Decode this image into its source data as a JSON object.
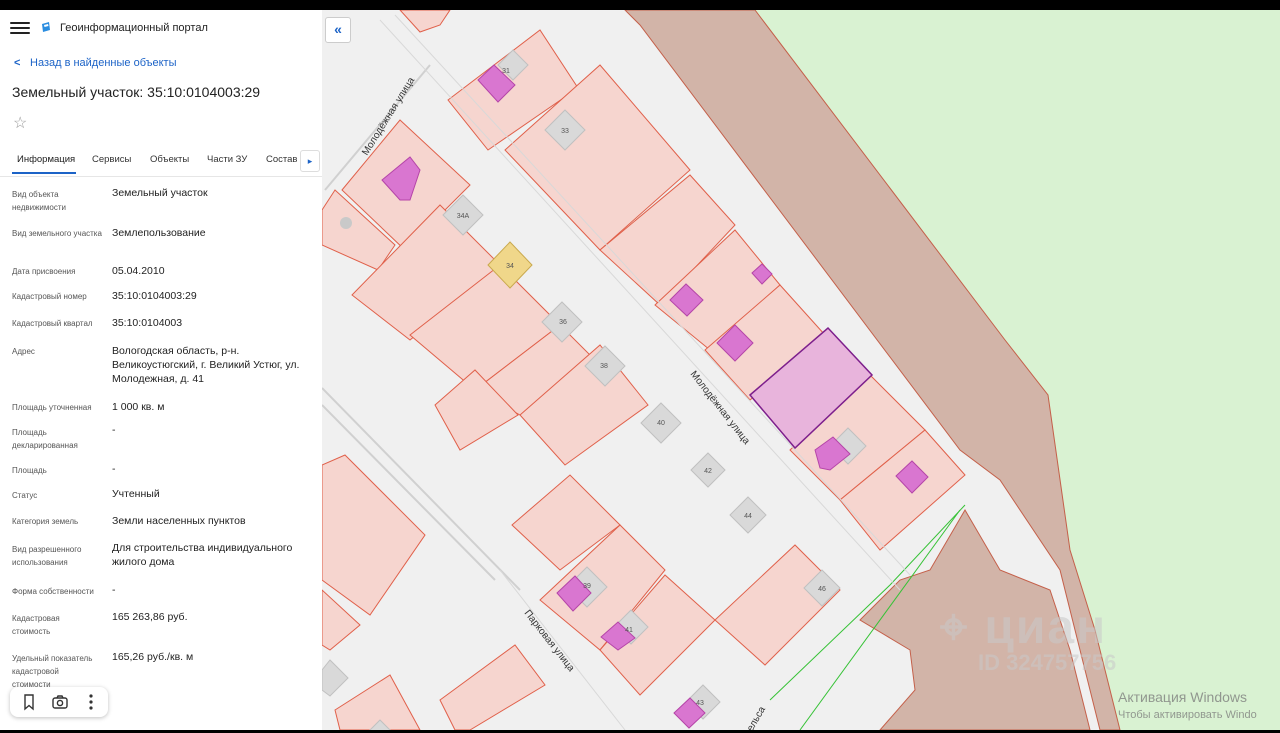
{
  "header": {
    "app_title": "Геоинформационный портал"
  },
  "nav": {
    "back_label": "Назад в найденные объекты"
  },
  "object": {
    "title": "Земельный участок: 35:10:0104003:29"
  },
  "tabs": [
    "Информация",
    "Сервисы",
    "Объекты",
    "Части ЗУ",
    "Состав"
  ],
  "active_tab": "Информация",
  "info": [
    {
      "label": "Вид объекта недвижимости",
      "value": "Земельный участок"
    },
    {
      "label": "Вид земельного участка",
      "value": "Землепользование"
    },
    {
      "label": "Дата присвоения",
      "value": "05.04.2010"
    },
    {
      "label": "Кадастровый номер",
      "value": "35:10:0104003:29"
    },
    {
      "label": "Кадастровый квартал",
      "value": "35:10:0104003"
    },
    {
      "label": "Адрес",
      "value": "Вологодская область, р-н. Великоустюгский, г. Великий Устюг, ул. Молодежная, д. 41"
    },
    {
      "label": "Площадь уточненная",
      "value": "1 000 кв. м"
    },
    {
      "label": "Площадь декларированная",
      "value": "-"
    },
    {
      "label": "Площадь",
      "value": "-"
    },
    {
      "label": "Статус",
      "value": "Учтенный"
    },
    {
      "label": "Категория земель",
      "value": "Земли населенных пунктов"
    },
    {
      "label": "Вид разрешенного использования",
      "value": "Для строительства индивидуального жилого дома"
    },
    {
      "label": "Форма собственности",
      "value": "-"
    },
    {
      "label": "Кадастровая стоимость",
      "value": "165 263,86 руб."
    },
    {
      "label": "Удельный показатель кадастровой стоимости",
      "value": "165,26 руб./кв. м"
    }
  ],
  "map": {
    "streets": {
      "molodezhnaya_1": "Молодёжная улица",
      "molodezhnaya_2": "Молодёжная улица",
      "parkovaya": "Парковая улица",
      "partial": "ельса"
    },
    "house_numbers": {
      "n31": "31",
      "n33": "33",
      "n34a": "34А",
      "n34": "34",
      "n36": "36",
      "n38": "38",
      "n40": "40",
      "n42": "42",
      "n44": "44",
      "n46": "46",
      "n39": "39",
      "n41": "41",
      "n43": "43"
    }
  },
  "watermark": {
    "brand": "циан",
    "id": "ID 324757756"
  },
  "windows": {
    "line1": "Активация Windows",
    "line2": "Чтобы активировать Windo"
  },
  "colors": {
    "accent": "#1c63c7",
    "parcel_fill": "#f6d5cf",
    "parcel_stroke": "#e0604a",
    "building": "#d976d0",
    "selected": "#7d1f8c",
    "forest": "#d9f2d2",
    "road_zone": "#d2b4a8"
  },
  "icons": {
    "menu": "hamburger-icon",
    "star": "star-icon",
    "bookmark": "bookmark-icon",
    "camera": "camera-icon",
    "more": "more-vertical-icon"
  }
}
